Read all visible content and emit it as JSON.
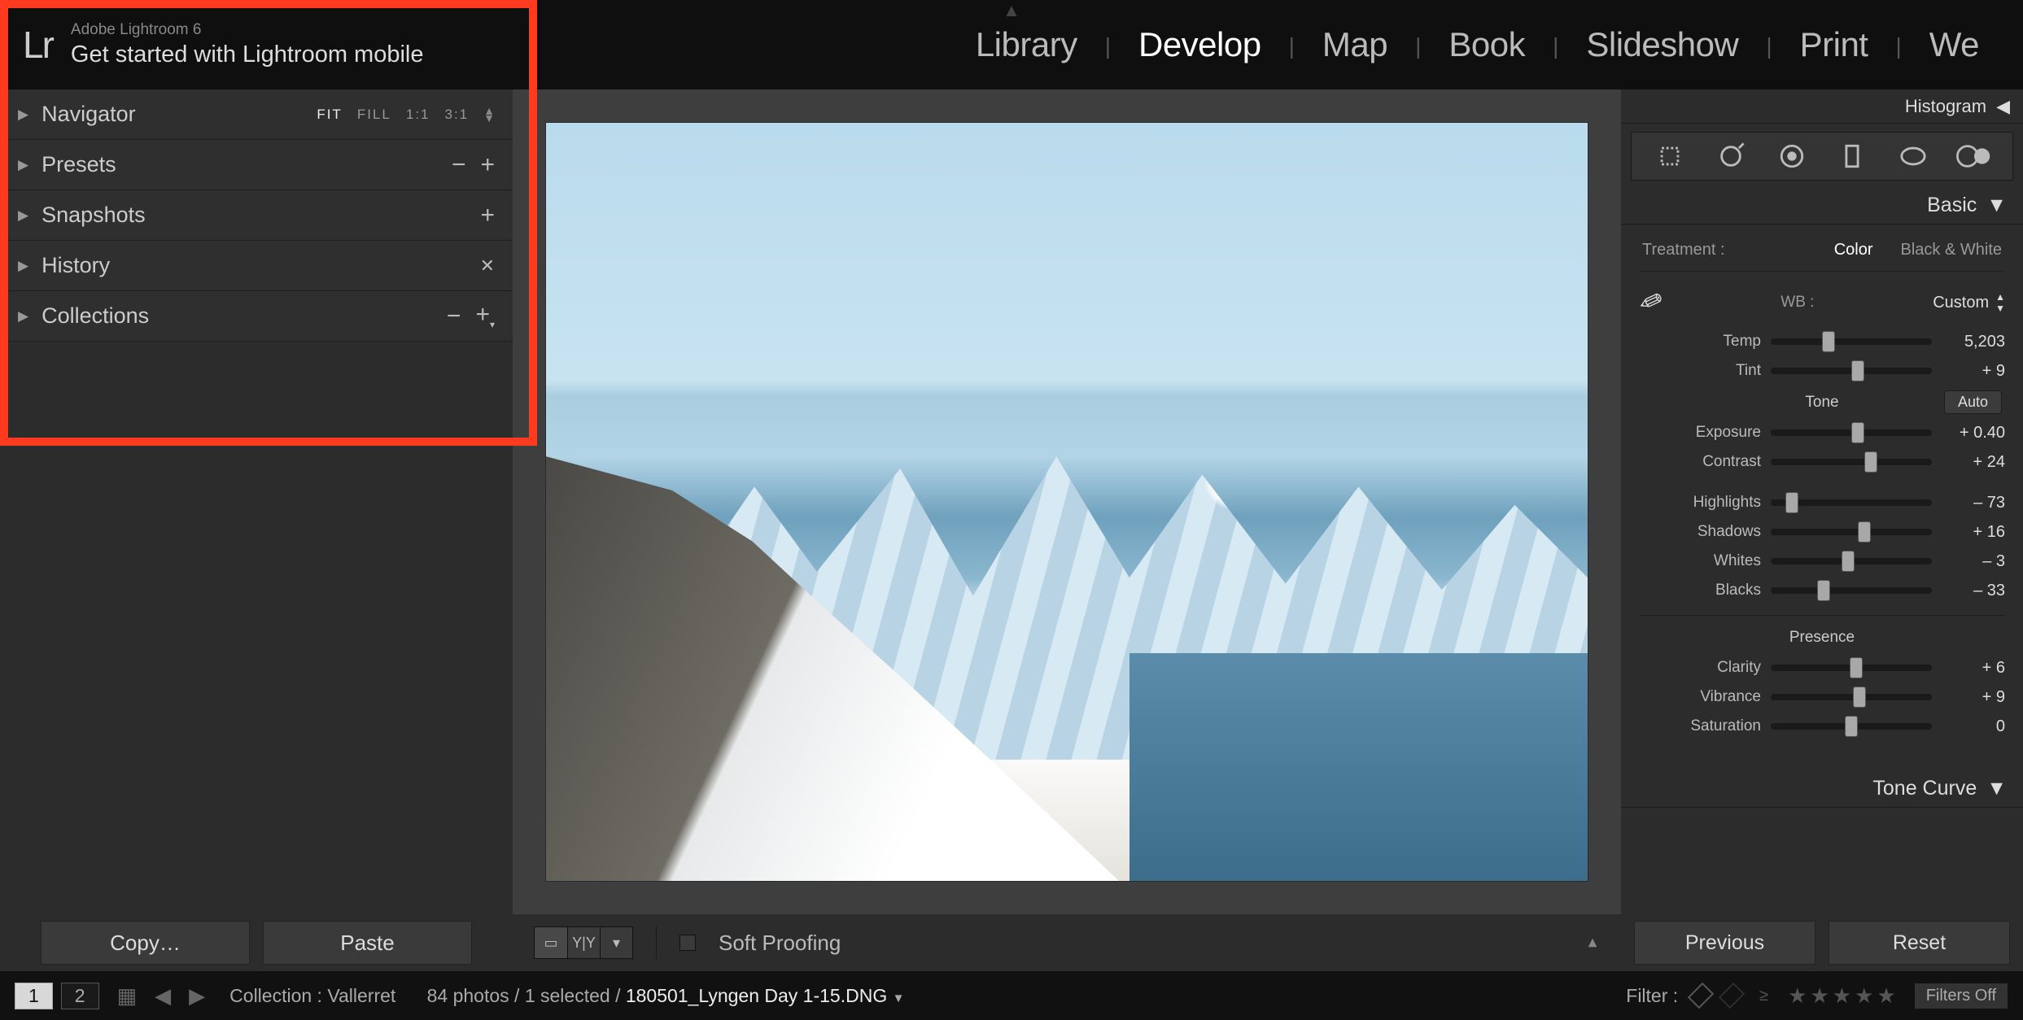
{
  "header": {
    "logo": "Lr",
    "app_title": "Adobe Lightroom 6",
    "app_subtitle": "Get started with Lightroom mobile",
    "modules": [
      "Library",
      "Develop",
      "Map",
      "Book",
      "Slideshow",
      "Print",
      "We"
    ],
    "active_module": "Develop"
  },
  "left_panel": {
    "navigator": {
      "label": "Navigator",
      "zoom": [
        "FIT",
        "FILL",
        "1:1",
        "3:1"
      ],
      "zoom_sel": "FIT"
    },
    "presets": {
      "label": "Presets"
    },
    "snapshots": {
      "label": "Snapshots"
    },
    "history": {
      "label": "History"
    },
    "collections": {
      "label": "Collections"
    }
  },
  "left_buttons": {
    "copy": "Copy…",
    "paste": "Paste"
  },
  "center_bar": {
    "soft_proof": "Soft Proofing"
  },
  "right_panel": {
    "histogram": "Histogram",
    "basic": "Basic",
    "treatment": {
      "label": "Treatment :",
      "color": "Color",
      "bw": "Black & White",
      "active": "Color"
    },
    "wb": {
      "label": "WB :",
      "value": "Custom"
    },
    "temp": {
      "label": "Temp",
      "value": "5,203",
      "pos": 36
    },
    "tint": {
      "label": "Tint",
      "value": "+ 9",
      "pos": 54
    },
    "tone": {
      "label": "Tone",
      "auto": "Auto"
    },
    "exposure": {
      "label": "Exposure",
      "value": "+ 0.40",
      "pos": 54
    },
    "contrast": {
      "label": "Contrast",
      "value": "+ 24",
      "pos": 62
    },
    "highlights": {
      "label": "Highlights",
      "value": "– 73",
      "pos": 13
    },
    "shadows": {
      "label": "Shadows",
      "value": "+ 16",
      "pos": 58
    },
    "whites": {
      "label": "Whites",
      "value": "– 3",
      "pos": 48
    },
    "blacks": {
      "label": "Blacks",
      "value": "– 33",
      "pos": 33
    },
    "presence": {
      "label": "Presence"
    },
    "clarity": {
      "label": "Clarity",
      "value": "+ 6",
      "pos": 53
    },
    "vibrance": {
      "label": "Vibrance",
      "value": "+ 9",
      "pos": 55
    },
    "saturation": {
      "label": "Saturation",
      "value": "0",
      "pos": 50
    },
    "tone_curve": "Tone Curve"
  },
  "right_buttons": {
    "prev": "Previous",
    "reset": "Reset"
  },
  "bottom": {
    "pages": [
      "1",
      "2"
    ],
    "collection_label": "Collection : ",
    "collection_name": "Vallerret",
    "count": "84 photos / 1 selected / ",
    "filename": "180501_Lyngen Day 1-15.DNG",
    "filter_label": "Filter :",
    "filters_off": "Filters Off"
  }
}
